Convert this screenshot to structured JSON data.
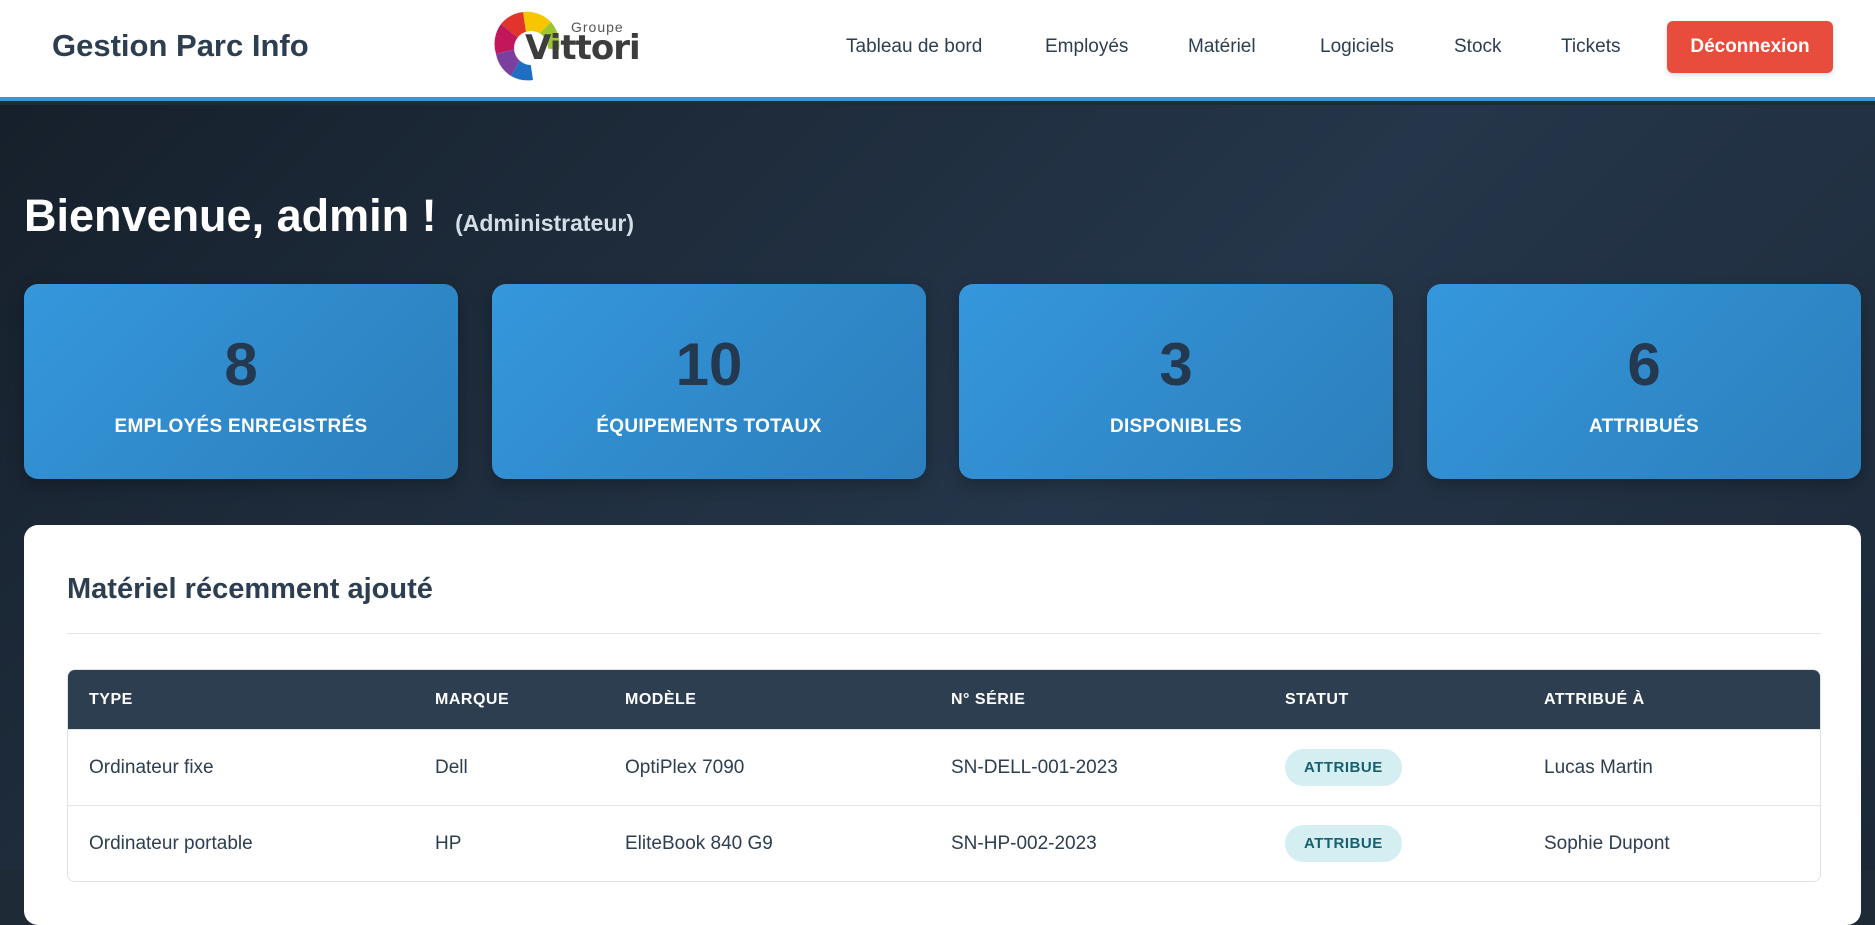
{
  "header": {
    "brand": "Gestion Parc Info",
    "logo": {
      "groupe": "Groupe",
      "name": "Vittori"
    },
    "nav": [
      {
        "label": "Tableau de bord"
      },
      {
        "label": "Employés"
      },
      {
        "label": "Matériel"
      },
      {
        "label": "Logiciels"
      },
      {
        "label": "Stock"
      },
      {
        "label": "Tickets"
      }
    ],
    "logout_label": "Déconnexion"
  },
  "welcome": {
    "greeting": "Bienvenue, admin !",
    "role": "(Administrateur)"
  },
  "stats": [
    {
      "value": "8",
      "label": "EMPLOYÉS ENREGISTRÉS"
    },
    {
      "value": "10",
      "label": "ÉQUIPEMENTS TOTAUX"
    },
    {
      "value": "3",
      "label": "DISPONIBLES"
    },
    {
      "value": "6",
      "label": "ATTRIBUÉS"
    }
  ],
  "recent": {
    "title": "Matériel récemment ajouté",
    "columns": [
      "TYPE",
      "MARQUE",
      "MODÈLE",
      "N° SÉRIE",
      "STATUT",
      "ATTRIBUÉ À"
    ],
    "rows": [
      {
        "type": "Ordinateur fixe",
        "marque": "Dell",
        "modele": "OptiPlex 7090",
        "serie": "SN-DELL-001-2023",
        "statut": "ATTRIBUE",
        "attribue": "Lucas Martin"
      },
      {
        "type": "Ordinateur portable",
        "marque": "HP",
        "modele": "EliteBook 840 G9",
        "serie": "SN-HP-002-2023",
        "statut": "ATTRIBUE",
        "attribue": "Sophie Dupont"
      }
    ]
  },
  "colors": {
    "accent": "#3498db",
    "logout": "#e74c3c",
    "table_header": "#2d3e50",
    "badge_bg": "#d4eef2",
    "badge_text": "#16606f"
  }
}
